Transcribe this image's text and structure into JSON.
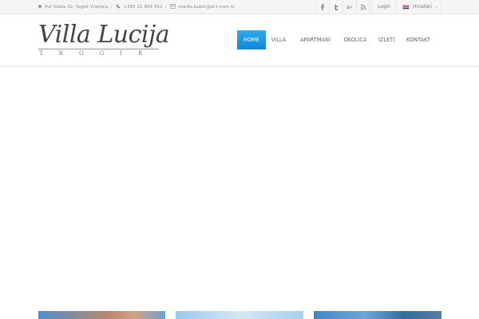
{
  "topbar": {
    "address": "Put Sedla 32, Seget Vranjica",
    "phone": "+385 21 894 352",
    "email": "marko.bubic@st.t-com.hr",
    "separator": "/",
    "social": [
      {
        "name": "facebook",
        "icon": "facebook-icon"
      },
      {
        "name": "twitter",
        "icon": "twitter-icon"
      },
      {
        "name": "google-plus",
        "icon": "google-plus-icon"
      },
      {
        "name": "rss",
        "icon": "rss-icon"
      }
    ],
    "login_label": "Login",
    "language": "Hrvatski"
  },
  "logo": {
    "title": "Villa Lucija",
    "subtitle": "TROGIR"
  },
  "nav": {
    "items": [
      "HOME",
      "VILLA",
      "APARTMANI",
      "OKOLICA",
      "IZLETI",
      "KONTAKT"
    ],
    "active": "HOME"
  },
  "colors": {
    "accent": "#1a94e2",
    "topbar_bg": "#f5f5f5",
    "text": "#666666"
  }
}
